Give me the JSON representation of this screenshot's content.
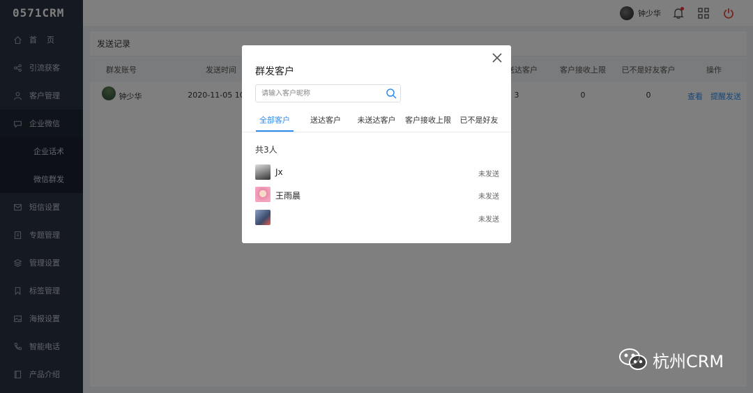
{
  "logo": "0571CRM",
  "sidebar": {
    "items": [
      {
        "label": "首    页",
        "icon": "home-icon"
      },
      {
        "label": "引流获客",
        "icon": "share-icon"
      },
      {
        "label": "客户管理",
        "icon": "user-icon"
      },
      {
        "label": "企业微信",
        "icon": "chat-icon"
      },
      {
        "label": "短信设置",
        "icon": "mail-icon"
      },
      {
        "label": "专题管理",
        "icon": "topic-icon"
      },
      {
        "label": "管理设置",
        "icon": "layers-icon"
      },
      {
        "label": "标签管理",
        "icon": "bookmark-icon"
      },
      {
        "label": "海报设置",
        "icon": "image-icon"
      },
      {
        "label": "智能电话",
        "icon": "phone-icon"
      },
      {
        "label": "产品介绍",
        "icon": "book-icon"
      }
    ],
    "subitems": [
      {
        "label": "企业话术"
      },
      {
        "label": "微信群发"
      }
    ]
  },
  "topbar": {
    "username": "钟少华"
  },
  "panel": {
    "title": "发送记录",
    "columns": [
      "群发账号",
      "发送时间",
      "送达客户",
      "客户接收上限",
      "已不是好友客户",
      "操作"
    ],
    "row": {
      "account": "钟少华",
      "time": "2020-11-05 10",
      "delivered": "3",
      "limit": "0",
      "not_friend": "0",
      "action_view": "查看",
      "action_remind": "提醒发送"
    }
  },
  "modal": {
    "title": "群发客户",
    "search_placeholder": "请输入客户昵称",
    "tabs": [
      "全部客户",
      "送达客户",
      "未送达客户",
      "客户接收上限",
      "已不是好友"
    ],
    "count_text": "共3人",
    "customers": [
      {
        "name": "Jx",
        "status": "未发送"
      },
      {
        "name": "王雨晨",
        "status": "未发送"
      },
      {
        "name": "",
        "status": "未发送"
      }
    ]
  },
  "watermark": "杭州CRM",
  "colors": {
    "accent": "#2d8cf0",
    "sidebar": "#2b3445",
    "power": "#e84a3c"
  }
}
